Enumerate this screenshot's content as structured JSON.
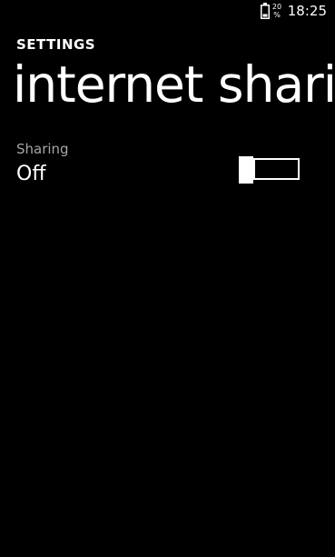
{
  "status_bar": {
    "battery_icon": "battery-icon",
    "battery_percent_top": "20",
    "battery_percent_bottom": "%",
    "time": "18:25"
  },
  "header": {
    "section": "SETTINGS",
    "title": "internet sharing"
  },
  "sharing": {
    "label": "Sharing",
    "value": "Off",
    "toggle_state": "off"
  },
  "colors": {
    "background": "#000000",
    "foreground": "#ffffff",
    "secondary_text": "#a6a6a6"
  }
}
